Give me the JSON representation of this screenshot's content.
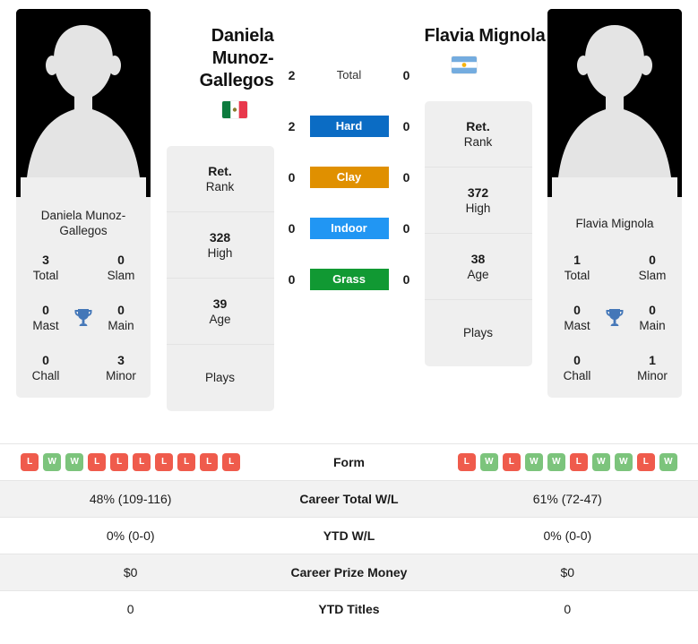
{
  "players": {
    "left": {
      "title": "Daniela Munoz-Gallegos",
      "card_name": "Daniela Munoz-Gallegos",
      "flag": "mexico-flag",
      "trophies": [
        {
          "value": "3",
          "label": "Total"
        },
        {
          "value": "0",
          "label": "Slam"
        },
        {
          "value": "0",
          "label": "Mast"
        },
        {
          "value": "0",
          "label": "Main"
        },
        {
          "value": "0",
          "label": "Chall"
        },
        {
          "value": "3",
          "label": "Minor"
        }
      ],
      "ranks": [
        {
          "value": "Ret.",
          "label": "Rank"
        },
        {
          "value": "328",
          "label": "High"
        },
        {
          "value": "39",
          "label": "Age"
        },
        {
          "value": "",
          "label": "Plays"
        }
      ],
      "form": [
        "L",
        "W",
        "W",
        "L",
        "L",
        "L",
        "L",
        "L",
        "L",
        "L"
      ]
    },
    "right": {
      "title": "Flavia Mignola",
      "card_name": "Flavia Mignola",
      "flag": "argentina-flag",
      "trophies": [
        {
          "value": "1",
          "label": "Total"
        },
        {
          "value": "0",
          "label": "Slam"
        },
        {
          "value": "0",
          "label": "Mast"
        },
        {
          "value": "0",
          "label": "Main"
        },
        {
          "value": "0",
          "label": "Chall"
        },
        {
          "value": "1",
          "label": "Minor"
        }
      ],
      "ranks": [
        {
          "value": "Ret.",
          "label": "Rank"
        },
        {
          "value": "372",
          "label": "High"
        },
        {
          "value": "38",
          "label": "Age"
        },
        {
          "value": "",
          "label": "Plays"
        }
      ],
      "form": [
        "L",
        "W",
        "L",
        "W",
        "W",
        "L",
        "W",
        "W",
        "L",
        "W"
      ]
    }
  },
  "surfaces": [
    {
      "name": "Total",
      "left": "2",
      "right": "0",
      "color": "transparent",
      "plain": true
    },
    {
      "name": "Hard",
      "left": "2",
      "right": "0",
      "color": "#0b6cc4",
      "plain": false
    },
    {
      "name": "Clay",
      "left": "0",
      "right": "0",
      "color": "#e09000",
      "plain": false
    },
    {
      "name": "Indoor",
      "left": "0",
      "right": "0",
      "color": "#2196f3",
      "plain": false
    },
    {
      "name": "Grass",
      "left": "0",
      "right": "0",
      "color": "#119933",
      "plain": false
    }
  ],
  "table": {
    "form_label": "Form",
    "rows": [
      {
        "left": "48% (109-116)",
        "label": "Career Total W/L",
        "right": "61% (72-47)"
      },
      {
        "left": "0% (0-0)",
        "label": "YTD W/L",
        "right": "0% (0-0)"
      },
      {
        "left": "$0",
        "label": "Career Prize Money",
        "right": "$0"
      },
      {
        "left": "0",
        "label": "YTD Titles",
        "right": "0"
      }
    ]
  },
  "colors": {
    "card_bg": "#efefef",
    "win_badge": "#7cc47c",
    "loss_badge": "#ef5b4c",
    "stripe": "#f2f2f2"
  }
}
